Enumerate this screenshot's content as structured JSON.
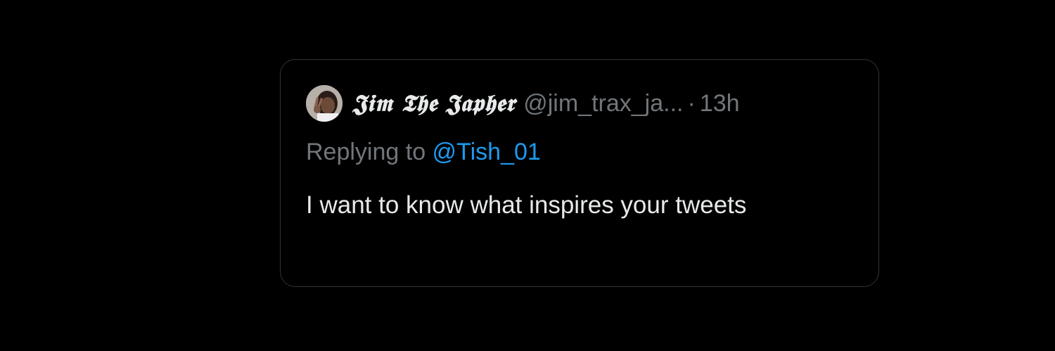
{
  "quote": {
    "author": {
      "display_name": "𝕵𝖎𝖒 𝕿𝖍𝖊 𝕵𝖆𝖕𝖍𝖊𝖗",
      "handle": "@jim_trax_ja...",
      "separator": "·",
      "timestamp": "13h"
    },
    "reply": {
      "prefix": "Replying to ",
      "handle": "@Tish_01"
    },
    "text": "I want to know what inspires your tweets"
  },
  "colors": {
    "background": "#000000",
    "border": "#2f3336",
    "primary_text": "#e7e9ea",
    "secondary_text": "#71767b",
    "link": "#1d9bf0"
  }
}
